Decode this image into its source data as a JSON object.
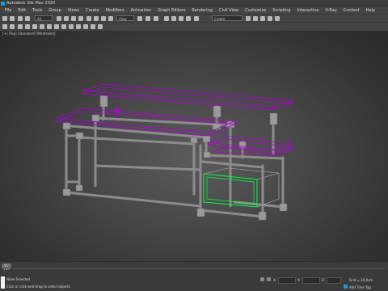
{
  "window": {
    "title": "Autodesk 3ds Max 2020"
  },
  "menu": [
    "File",
    "Edit",
    "Tools",
    "Group",
    "Views",
    "Create",
    "Modifiers",
    "Animation",
    "Graph Editors",
    "Rendering",
    "Civil View",
    "Customize",
    "Scripting",
    "Interactive",
    "V-Ray",
    "Content",
    "Help"
  ],
  "toolbar": {
    "selection_filter": "All",
    "reference_coord": "View",
    "named_selection": "Create Selection Se"
  },
  "viewport": {
    "label": "[+] [Top] [Standard] [Wireframe]"
  },
  "timeline": {
    "frame_counter": "0 / 100"
  },
  "status": {
    "selection": "None Selected",
    "prompt": "Click or click-and-drag to select objects",
    "x_label": "X:",
    "y_label": "Y:",
    "z_label": "Z:",
    "grid": "Grid = 10,0cm",
    "add_time_tag": "Add Time Tag"
  },
  "colors": {
    "selection": "#b000d8",
    "highlight": "#00ff44",
    "pipe": "#8f8f8f",
    "pipe_dark": "#707070"
  }
}
